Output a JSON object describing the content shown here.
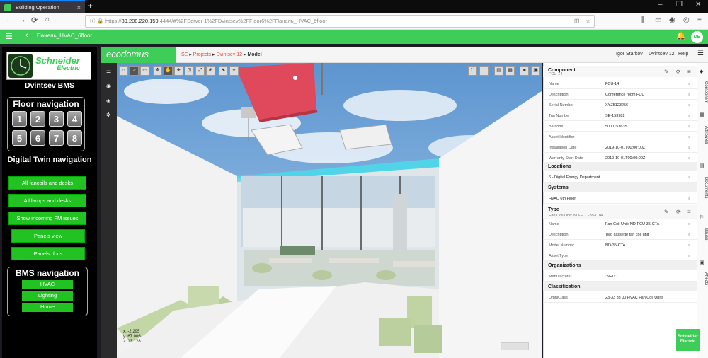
{
  "browser": {
    "tab_title": "Building Operation WebStation",
    "tab_close": "×",
    "newtab": "+",
    "url_prefix": "https://",
    "url_host": "89.208.220.159",
    "url_rest": ":4444/#%2FServer 1%2FDvintsev%2FFloor6%2FПанель_HVAC_6floor",
    "win_min": "–",
    "win_max": "❐",
    "win_close": "✕"
  },
  "app": {
    "page_title": "Панель_HVAC_6floor",
    "avatar": "DE"
  },
  "bms": {
    "brand_line1": "Schneider",
    "brand_line2": "Electric",
    "site_name": "Dvintsev BMS",
    "floor_title": "Floor navigation",
    "floors": [
      "1",
      "2",
      "3",
      "4",
      "5",
      "6",
      "7",
      "8"
    ],
    "dt_title": "Digital Twin navigation",
    "dt_buttons": [
      "All fancoils and desks",
      "All lamps and desks",
      "Show incoming FM issues",
      "Panels view",
      "Panels docs"
    ],
    "bms_nav_title": "BMS navigation",
    "bms_buttons": [
      "HVAC",
      "Lighting",
      "Home"
    ]
  },
  "eco": {
    "logo": "ecodomus",
    "crumbs": [
      "SE",
      "Projects",
      "Dvintsev 12",
      "Model"
    ],
    "user": "Igor Starkov",
    "project": "Dvintsev 12",
    "help": "Help"
  },
  "viewer": {
    "coord_x": "x: -2.295",
    "coord_y": "y: 67.006",
    "coord_z": "z: 13.128"
  },
  "props": {
    "component_title": "Component",
    "component_sub": "FCU-14",
    "component_rows": [
      {
        "label": "Name",
        "value": "FCU-14"
      },
      {
        "label": "Description",
        "value": "Conference room FCU"
      },
      {
        "label": "Serial Number",
        "value": "XYZ5123256"
      },
      {
        "label": "Tag Number",
        "value": "SE-153982"
      },
      {
        "label": "Barcode",
        "value": "5000153635"
      },
      {
        "label": "Asset Identifier",
        "value": ""
      },
      {
        "label": "Installation Date",
        "value": "2019-10-01T00:00:00Z"
      },
      {
        "label": "Warranty Start Date",
        "value": "2019-10-01T00:00:00Z"
      }
    ],
    "locations_title": "Locations",
    "location": "6 - Digital Energy Department",
    "systems_title": "Systems",
    "system": "HVAC 6th Floor",
    "type_title": "Type",
    "type_sub": "Fan Coil Unit: ND-FCU-35-CTA",
    "type_rows": [
      {
        "label": "Name",
        "value": "Fan Coil Unit: ND-FCU-35-CTA"
      },
      {
        "label": "Description",
        "value": "Two cassette fan coil unit"
      },
      {
        "label": "Model Number",
        "value": "ND-35-CTA"
      },
      {
        "label": "Asset Type",
        "value": ""
      }
    ],
    "org_title": "Organizations",
    "manufacturer_label": "Manufacturer",
    "manufacturer": "\"NED\"",
    "class_title": "Classification",
    "omni_label": "OmniClass",
    "omni": "23-33 33 00 HVAC Fan Coil Units"
  },
  "vtabs": [
    "Component",
    "Attributes",
    "Documents",
    "Issues",
    "Affects"
  ],
  "se_badge": "Schneider Electric",
  "colors": {
    "accent": "#3dcd58",
    "breadcrumb": "#e74c3c",
    "duct_red": "#e0485c"
  }
}
